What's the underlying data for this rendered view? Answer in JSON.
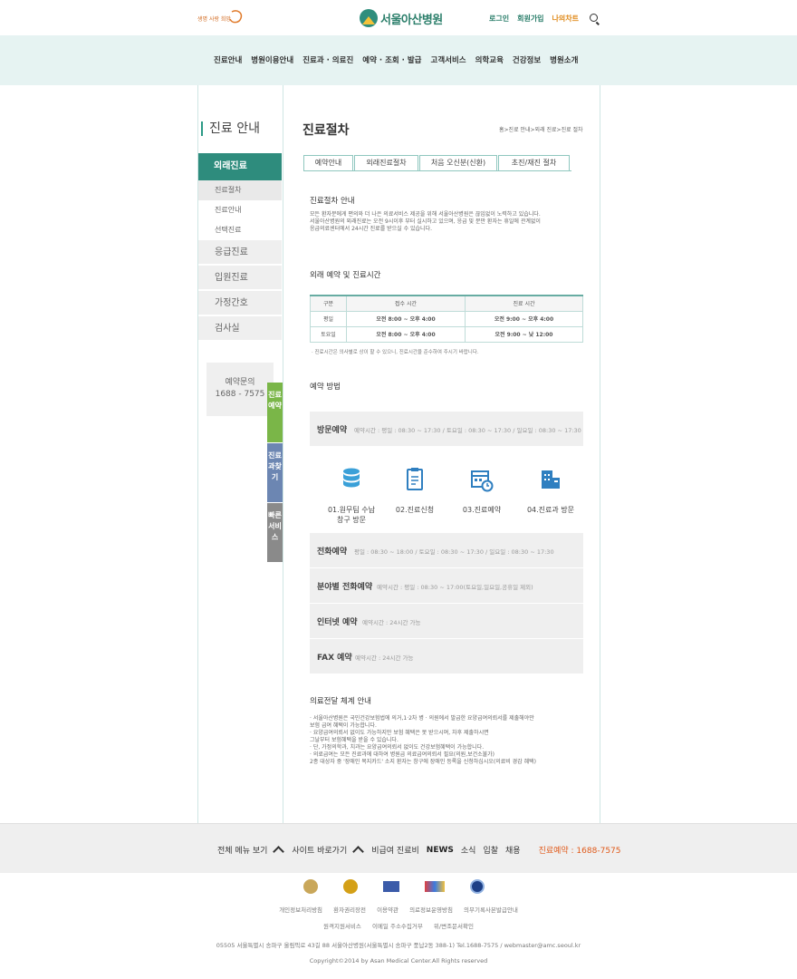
{
  "header": {
    "slogan": "생명 사랑 희망 AMC",
    "logo_text": "서울아산병원",
    "utils": {
      "login": "로그인",
      "join": "회원가입",
      "mychart": "나의차트"
    }
  },
  "gnb": [
    "진료안내",
    "병원이용안내",
    "진료과 · 의료진",
    "예약 · 조회 · 발급",
    "고객서비스",
    "의학교육",
    "건강정보",
    "병원소개"
  ],
  "lnb": {
    "title": "진료 안내",
    "active": "외래진료",
    "subs": [
      "진료절차",
      "진료안내",
      "선택진료"
    ],
    "cats": [
      "응급진료",
      "입원진료",
      "가정간호",
      "검사실"
    ],
    "contact_label": "예약문의",
    "contact_tel": "1688 - 7575"
  },
  "quick_tabs": [
    "진료예약",
    "진료과찾기",
    "빠른서비스"
  ],
  "page": {
    "title": "진료절차",
    "breadcrumb": "홈>진료 안내>외래 진료>진료 절차",
    "tabs": [
      "예약안내",
      "외래진료절차",
      "처음 오신분(신환)",
      "초진/재진 절차"
    ]
  },
  "sections": {
    "guide_title": "진료절차 안내",
    "guide_lines": [
      "모든 환자분에게 편의와 더 나은 의료서비스 제공을 위해 서울아산병원은 끊임없이 노력하고 있습니다.",
      "서울아산병원의 외래진료는 오전 9시이후 부터 실시하고 있으며, 응급 및 분만 환자는 휴일에 관계없이",
      "응급의료센터에서 24시간 진료를 받으실 수 있습니다."
    ],
    "hours_title": "외래 예약 및 진료시간",
    "hours_headers": [
      "구분",
      "접수 시간",
      "진료 시간"
    ],
    "hours_rows": [
      [
        "평일",
        "오전 8:00 ~ 오후 4:00",
        "오전 9:00 ~ 오후 4:00"
      ],
      [
        "토요일",
        "오전 8:00 ~ 오후 4:00",
        "오전 9:00 ~ 낮 12:00"
      ]
    ],
    "hours_note": "· 진료시간은 의사별로 상이 할 수 있으니, 진료시간을 준수하여 주시기 바랍니다.",
    "method_title": "예약 방법",
    "visit": {
      "title": "방문예약",
      "desc": "예약시간 : 평일 : 08:30 ~ 17:30 / 토요일 : 08:30 ~ 17:30 / 일요일 : 08:30 ~ 17:30"
    },
    "steps": [
      {
        "icon": "database-icon",
        "label": "01.원무팀 수납\n창구 방문"
      },
      {
        "icon": "clipboard-icon",
        "label": "02.진료신청"
      },
      {
        "icon": "calendar-icon",
        "label": "03.진료예약"
      },
      {
        "icon": "building-icon",
        "label": "04.진료과 방문"
      }
    ],
    "phone": {
      "title": "전화예약",
      "desc": "평일 : 08:30 ~ 18:00 / 토요일 : 08:30 ~ 17:30 / 일요일 : 08:30 ~ 17:30"
    },
    "dept_phone": {
      "title": "분야별 전화예약",
      "desc": "예약시간 : 평일 : 08:30 ~ 17:00(토요일,일요일,공휴일 제외)"
    },
    "internet": {
      "title": "인터넷 예약",
      "desc": "예약시간 : 24시간 가능"
    },
    "fax": {
      "title": "FAX 예약",
      "desc": "예약시간 : 24시간 가능"
    },
    "referral_title": "의료전달 체계 안내",
    "referral_lines": [
      "· 서울아산병원은 국민건강보험법에 의거,1·2차 병 · 의원에서 발급한 요양급여의뢰서를 제출해야만",
      "  보험 급여 혜택이 가능합니다.",
      "· 요양급여의뢰서 없이도 가능하지만 보험 혜택은 못 받으시며, 차후 제출하시면",
      "  그날부터 보험혜택을 받을 수 있습니다.",
      "· 단, 가정의학과, 치과는 요양급여의뢰서 없이도 건강보험혜택이 가능합니다.",
      "· 의료급여는 모든 진료과에 대하여 병원급 의료급여의뢰서 필요(의원,보건소불가)",
      "  2종 대상자 중 '장애인 복지카드' 소지 환자는 창구에 장애인 등록을 신청하십시오(의료비 경감 혜택)"
    ]
  },
  "footer": {
    "menu": [
      "전체 메뉴 보기",
      "사이트 바로가기",
      "비급여 진료비",
      "NEWS",
      "소식",
      "입찰",
      "채용"
    ],
    "tel": "진료예약 : 1688-7575",
    "links1": [
      "개인정보처리방침",
      "환자권리장전",
      "이용약관",
      "의료정보운영방침",
      "의무기록사본발급안내"
    ],
    "links2": [
      "원격지원서비스",
      "이메일 주소수집거부",
      "위/변조문서확인"
    ],
    "address": "05505 서울특별시 송파구 올림픽로 43길 88 서울아산병원(서울특별시 송파구 풍납2동 388-1) Tel.1688-7575 / webmaster@amc.seoul.kr",
    "copyright": "Copyright©2014 by Asan Medical Center.All Rights reserved"
  },
  "colors": {
    "accent": "#2e8c7d",
    "gnb_bg": "#e6f3f2",
    "tel": "#e05a1a"
  }
}
